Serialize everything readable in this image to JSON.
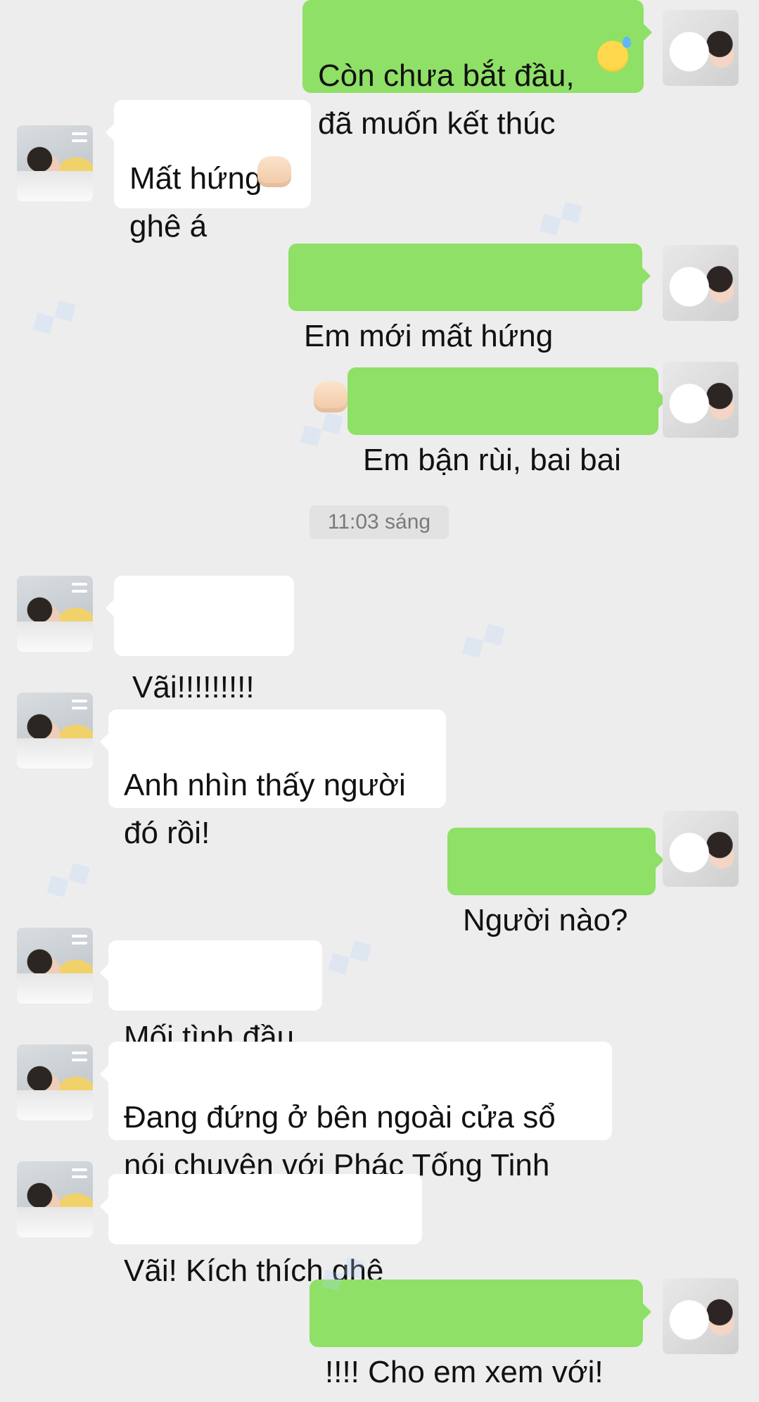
{
  "messages": [
    {
      "side": "right",
      "text": "Còn chưa bắt đầu,\nđã muốn kết thúc",
      "emoji": "sweat-smile"
    },
    {
      "side": "left",
      "text": "Mất hứng\nghê á",
      "emoji": "fist"
    },
    {
      "side": "right",
      "text": "Em mới mất hứng",
      "emoji": "fist"
    },
    {
      "side": "right",
      "text": "Em bận rùi, bai bai"
    },
    {
      "side": "left",
      "text": "Vãi!!!!!!!!!"
    },
    {
      "side": "left",
      "text": "Anh nhìn thấy người\nđó rồi!"
    },
    {
      "side": "right",
      "text": "Người nào?"
    },
    {
      "side": "left",
      "text": "Mối tình đầu"
    },
    {
      "side": "left",
      "text": "Đang đứng ở bên ngoài cửa sổ\nnói chuyện với Phác Tống Tinh"
    },
    {
      "side": "left",
      "text": "Vãi! Kích thích ghê"
    },
    {
      "side": "right",
      "text": "!!!! Cho em xem với!"
    }
  ],
  "timestamp": "11:03 sáng",
  "colors": {
    "background": "#ededed",
    "outgoing_bubble": "#8fe066",
    "incoming_bubble": "#ffffff",
    "timestamp_bg": "#e2e2e2"
  }
}
